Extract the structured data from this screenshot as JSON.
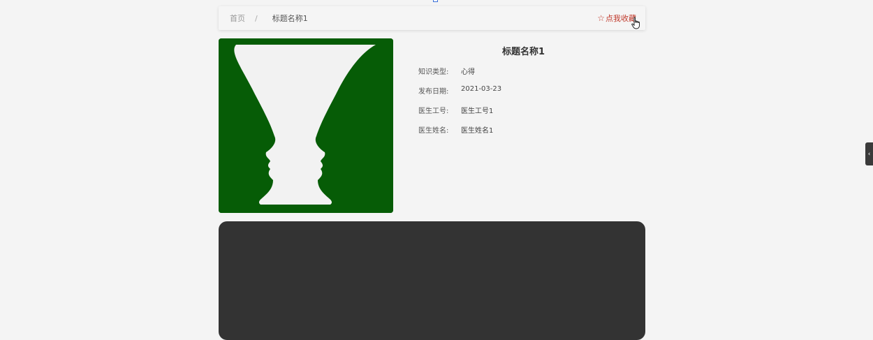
{
  "breadcrumb": {
    "home": "首页",
    "separator": "/",
    "current": "标题名称1"
  },
  "favorite": {
    "icon": "star-outline-icon",
    "label": "点我收藏",
    "color": "#c0392b"
  },
  "image": {
    "icon": "rubin-vase-image",
    "background": "#065c06"
  },
  "detail": {
    "title": "标题名称1",
    "fields": [
      {
        "label": "知识类型:",
        "value": "心得"
      },
      {
        "label": "发布日期:",
        "value": "2021-03-23"
      },
      {
        "label": "医生工号:",
        "value": "医生工号1"
      },
      {
        "label": "医生姓名:",
        "value": "医生姓名1"
      }
    ]
  },
  "video": {
    "background": "#333333"
  },
  "side_tab": {
    "icon": "chevron-left-icon",
    "glyph": "‹"
  }
}
